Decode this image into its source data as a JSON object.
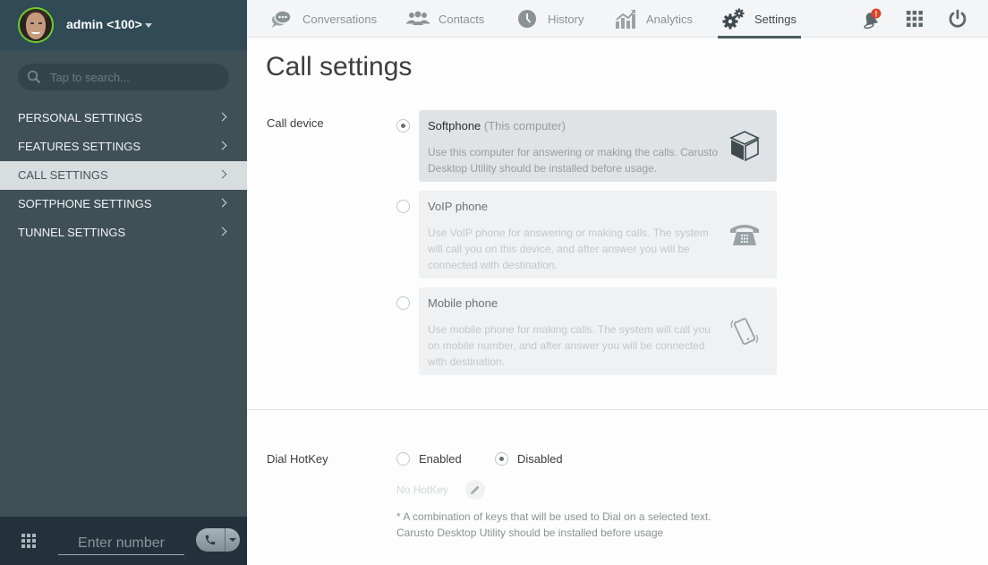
{
  "user": {
    "name": "admin <100>",
    "status_color": "#6fcc2e"
  },
  "search": {
    "placeholder": "Tap to search..."
  },
  "sidebar": {
    "items": [
      {
        "label": "PERSONAL SETTINGS",
        "active": false
      },
      {
        "label": "FEATURES SETTINGS",
        "active": false
      },
      {
        "label": "CALL SETTINGS",
        "active": true
      },
      {
        "label": "SOFTPHONE SETTINGS",
        "active": false
      },
      {
        "label": "TUNNEL SETTINGS",
        "active": false
      }
    ]
  },
  "dialer": {
    "placeholder": "Enter number",
    "value": ""
  },
  "nav": {
    "tabs": [
      {
        "label": "Conversations",
        "icon": "chat-bubbles-icon",
        "active": false
      },
      {
        "label": "Contacts",
        "icon": "contacts-group-icon",
        "active": false
      },
      {
        "label": "History",
        "icon": "clock-icon",
        "active": false
      },
      {
        "label": "Analytics",
        "icon": "analytics-chart-icon",
        "active": false
      },
      {
        "label": "Settings",
        "icon": "gears-icon",
        "active": true
      }
    ],
    "notification_badge": "!",
    "badge_color": "#d9452a"
  },
  "main": {
    "title": "Call settings",
    "call_device": {
      "label": "Call device",
      "selected": "softphone",
      "options": [
        {
          "id": "softphone",
          "title": "Softphone",
          "subtitle": "(This computer)",
          "description": "Use this computer for answering or making the calls. Carusto Desktop Utility should be installed before usage.",
          "icon": "cube-icon",
          "checked": true
        },
        {
          "id": "voip",
          "title": "VoIP phone",
          "subtitle": "",
          "description": "Use VoIP phone for answering or making calls. The system will call you on this device, and after answer you will be connected with destination.",
          "icon": "desk-phone-icon",
          "checked": false
        },
        {
          "id": "mobile",
          "title": "Mobile phone",
          "subtitle": "",
          "description": "Use mobile phone for making calls. The system will call you on mobile number, and after answer you will be connected with destination.",
          "icon": "mobile-phone-icon",
          "checked": false
        }
      ]
    },
    "dial_hotkey": {
      "label": "Dial HotKey",
      "enabled_label": "Enabled",
      "disabled_label": "Disabled",
      "selected": "disabled",
      "hotkey_value": "No HotKey",
      "note_line1": "* A combination of keys that will be used to Dial on a selected text.",
      "note_line2": "Carusto Desktop Utility should be installed before usage"
    }
  }
}
